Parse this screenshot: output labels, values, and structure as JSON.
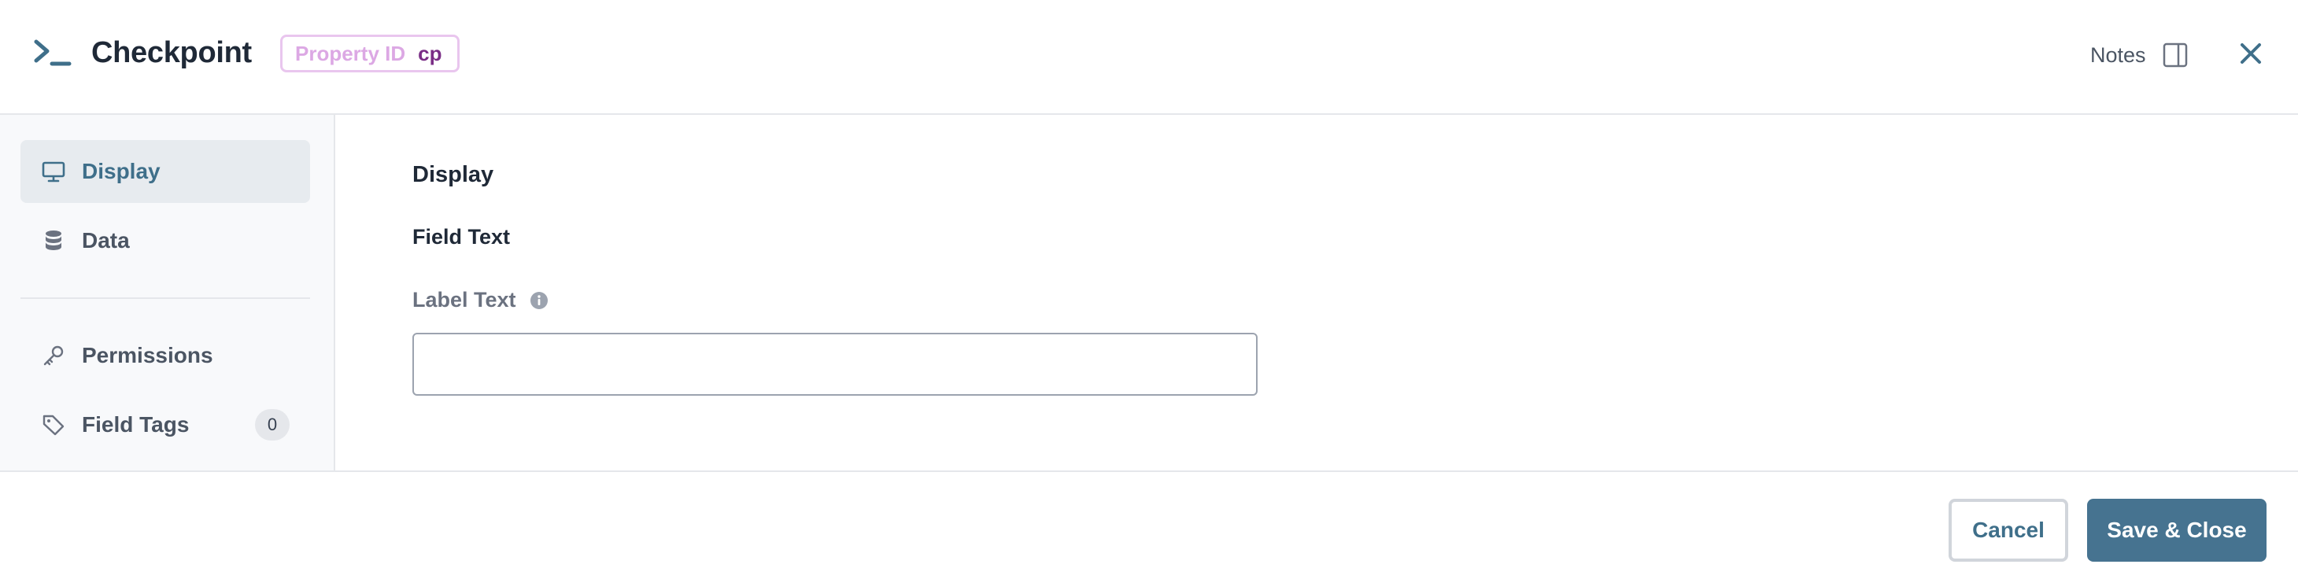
{
  "header": {
    "title": "Checkpoint",
    "property_id_label": "Property ID",
    "property_id_value": "cp",
    "notes_label": "Notes",
    "icons": {
      "app": "terminal-prompt-icon",
      "notes": "side-panel-icon",
      "close": "close-icon"
    }
  },
  "sidebar": {
    "items": [
      {
        "label": "Display",
        "icon": "monitor-icon",
        "active": true
      },
      {
        "label": "Data",
        "icon": "database-icon",
        "active": false
      },
      {
        "label": "Permissions",
        "icon": "key-icon",
        "active": false
      },
      {
        "label": "Field Tags",
        "icon": "tag-icon",
        "active": false,
        "count": "0"
      }
    ]
  },
  "main": {
    "section_title": "Display",
    "group_title": "Field Text",
    "label_text": {
      "label": "Label Text",
      "value": "",
      "icon": "info-icon"
    }
  },
  "footer": {
    "cancel_label": "Cancel",
    "save_label": "Save & Close"
  },
  "colors": {
    "accent": "#467390",
    "badge_border": "#e9c6ee",
    "badge_value": "#7a2e86",
    "sidebar_active_bg": "#e7ebef"
  }
}
